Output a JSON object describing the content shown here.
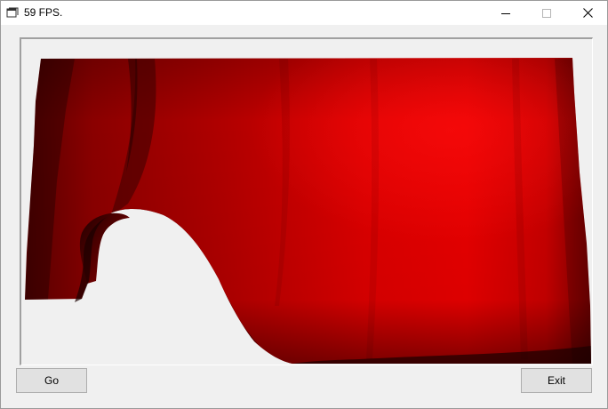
{
  "window": {
    "title": "59 FPS."
  },
  "title_buttons": {
    "minimize_icon": "minimize-icon",
    "maximize_icon": "maximize-icon",
    "close_icon": "close-icon"
  },
  "viewport": {
    "surface_color_dark": "#3a0000",
    "surface_color_mid": "#a00000",
    "surface_color_bright": "#ee0000",
    "background_color": "#f0f0f0"
  },
  "buttons": {
    "go_label": "Go",
    "exit_label": "Exit"
  }
}
